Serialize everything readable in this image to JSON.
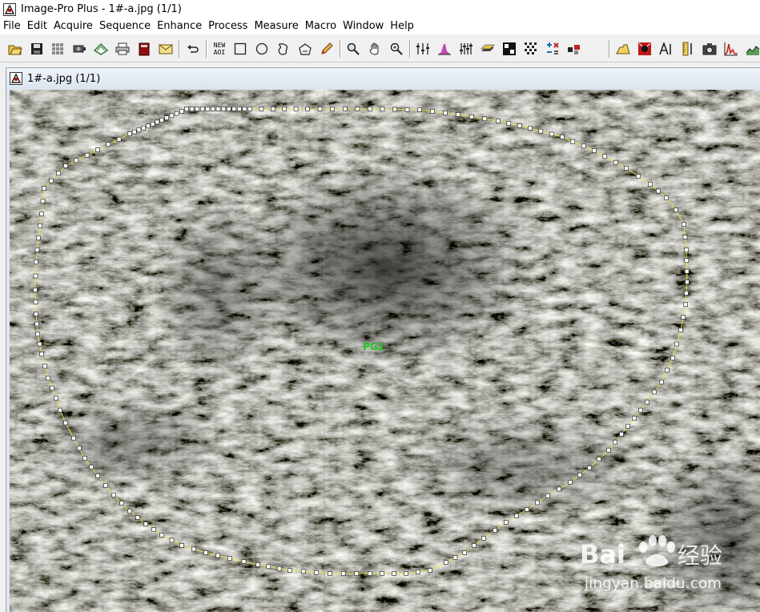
{
  "app": {
    "title": "Image-Pro Plus - 1#-a.jpg (1/1)"
  },
  "menu": [
    "File",
    "Edit",
    "Acquire",
    "Sequence",
    "Enhance",
    "Process",
    "Measure",
    "Macro",
    "Window",
    "Help"
  ],
  "toolbar": {
    "buttons": [
      {
        "name": "open-icon"
      },
      {
        "name": "save-icon"
      },
      {
        "name": "grid-icon"
      },
      {
        "name": "camera-capture-icon"
      },
      {
        "name": "scanner-icon"
      },
      {
        "name": "print-icon"
      },
      {
        "name": "database-icon"
      },
      {
        "name": "mail-icon"
      },
      {
        "name": "undo-icon"
      },
      {
        "name": "new-aoi-icon",
        "label": "NEW AOI"
      },
      {
        "name": "rectangle-aoi-icon"
      },
      {
        "name": "ellipse-aoi-icon"
      },
      {
        "name": "irregular-aoi-icon"
      },
      {
        "name": "magic-wand-icon"
      },
      {
        "name": "pencil-icon"
      },
      {
        "name": "zoom-icon"
      },
      {
        "name": "pan-hand-icon"
      },
      {
        "name": "zoom-fit-icon"
      },
      {
        "name": "contrast-icon"
      },
      {
        "name": "histogram-icon"
      },
      {
        "name": "equalize-icon"
      },
      {
        "name": "layers-icon"
      },
      {
        "name": "color-segment-icon"
      },
      {
        "name": "count-grid-icon"
      },
      {
        "name": "operations-icon"
      },
      {
        "name": "pattern-icon"
      },
      {
        "name": "measure-icon"
      },
      {
        "name": "color-cube-icon"
      },
      {
        "name": "text-icon"
      },
      {
        "name": "ruler-icon"
      },
      {
        "name": "snapshot-icon"
      },
      {
        "name": "line-profile-icon"
      },
      {
        "name": "surface-plot-icon"
      }
    ]
  },
  "document": {
    "title": "1#-a.jpg (1/1)",
    "roi_label": "PG1"
  },
  "watermark": {
    "brand": "Bai 经验",
    "url": "jingyan.baidu.com"
  },
  "colors": {
    "roi_line": "#e8e04a",
    "roi_label": "#1ec81e",
    "doc_frame": "#dfe6ee"
  }
}
